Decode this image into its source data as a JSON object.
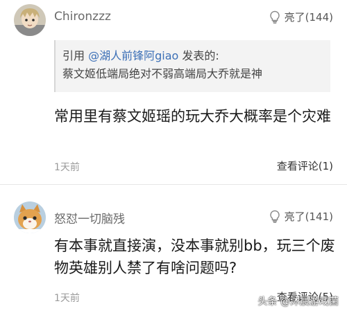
{
  "comments": [
    {
      "username": "Chironzzz",
      "like_label": "亮了(144)",
      "quote": {
        "prefix": "引用 ",
        "mention": "@湖人前锋阿giao",
        "suffix": " 发表的:",
        "text": "蔡文姬低端局绝对不弱高端局大乔就是神"
      },
      "text": "常用里有蔡文姬瑶的玩大乔大概率是个灾难",
      "time": "1天前",
      "reply_label": "查看评论(1)",
      "avatar_icon": "anime-boy-avatar-icon"
    },
    {
      "username": "怒怼一切脑残",
      "like_label": "亮了(141)",
      "text": "有本事就直接演，没本事就别bb，玩三个废物英雄别人禁了有啥问题吗?",
      "time": "1天前",
      "reply_label": "查看评论(5)",
      "avatar_icon": "cat-avatar-icon"
    }
  ],
  "watermark": "头条 @沐晨游戏菌",
  "colors": {
    "mention": "#3b6fb6",
    "quote_bg": "#f3f3f3",
    "meta_text": "#9a9a9a"
  }
}
